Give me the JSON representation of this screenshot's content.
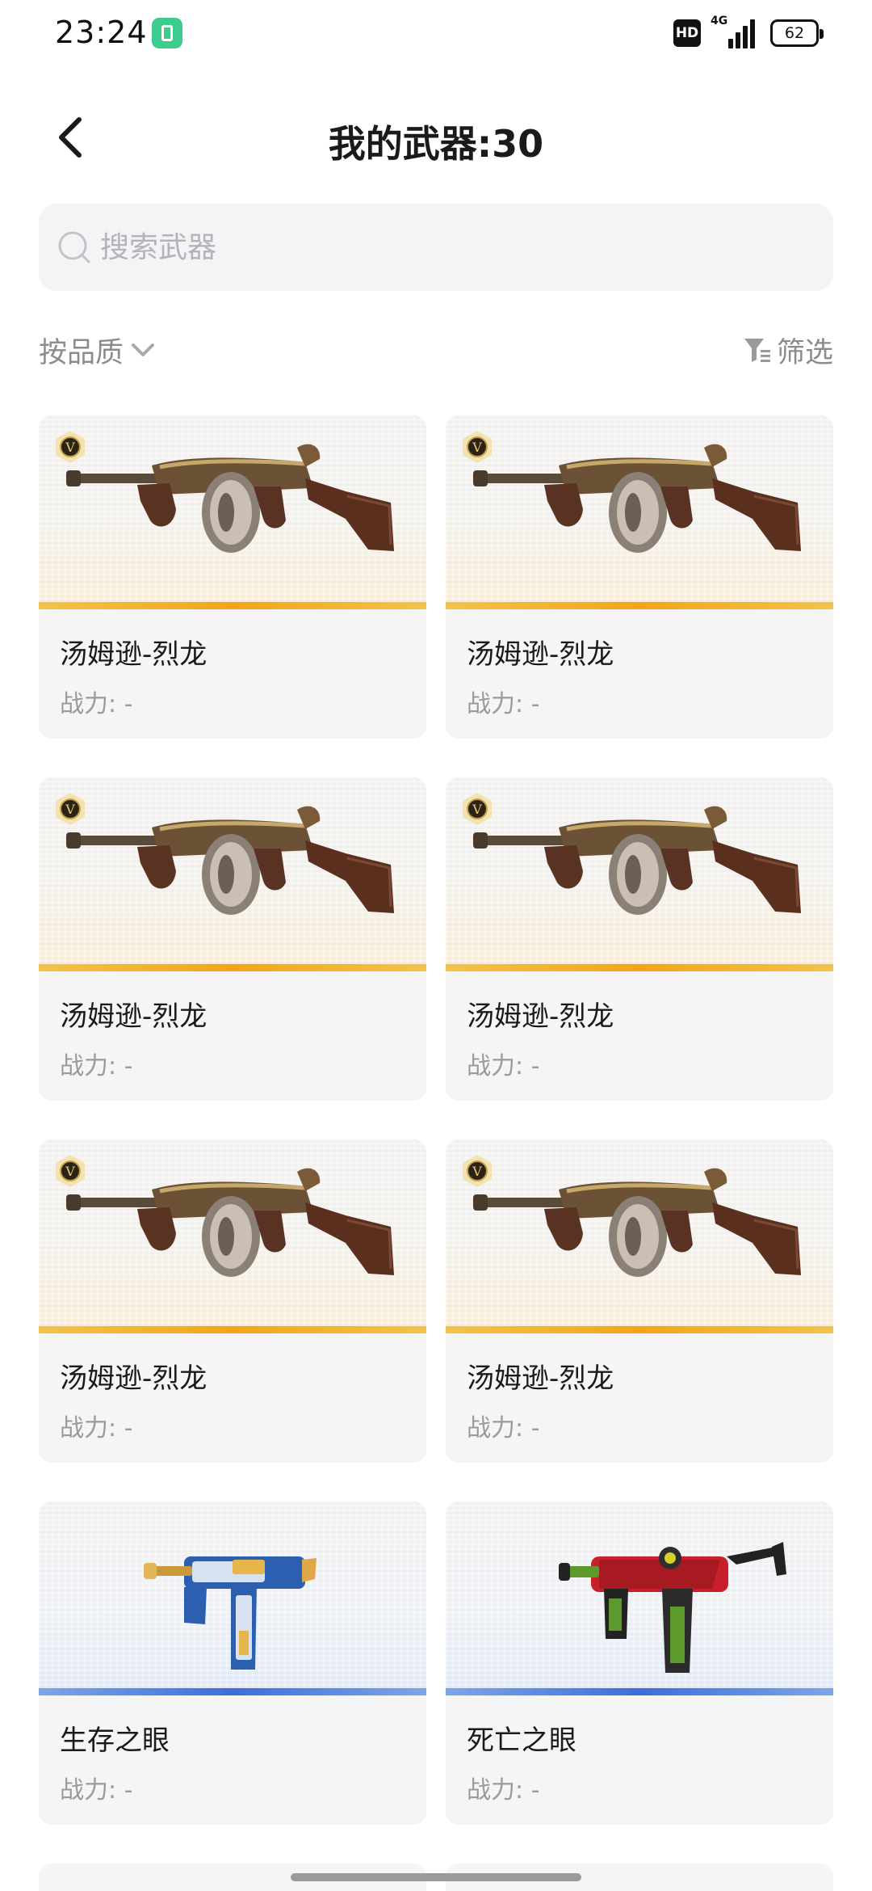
{
  "status_bar": {
    "time": "23:24",
    "hd": "HD",
    "network": "4G",
    "battery": "62"
  },
  "header": {
    "title": "我的武器:30"
  },
  "search": {
    "placeholder": "搜索武器"
  },
  "toolbar": {
    "sort_label": "按品质",
    "filter_label": "筛选"
  },
  "weapons": [
    {
      "name": "汤姆逊-烈龙",
      "power": "战力: -",
      "rarity": "gold",
      "badge": "V",
      "icon": "tommy-gun-dragon"
    },
    {
      "name": "汤姆逊-烈龙",
      "power": "战力: -",
      "rarity": "gold",
      "badge": "V",
      "icon": "tommy-gun-dragon"
    },
    {
      "name": "汤姆逊-烈龙",
      "power": "战力: -",
      "rarity": "gold",
      "badge": "V",
      "icon": "tommy-gun-dragon"
    },
    {
      "name": "汤姆逊-烈龙",
      "power": "战力: -",
      "rarity": "gold",
      "badge": "V",
      "icon": "tommy-gun-dragon"
    },
    {
      "name": "汤姆逊-烈龙",
      "power": "战力: -",
      "rarity": "gold",
      "badge": "V",
      "icon": "tommy-gun-dragon"
    },
    {
      "name": "汤姆逊-烈龙",
      "power": "战力: -",
      "rarity": "gold",
      "badge": "V",
      "icon": "tommy-gun-dragon"
    },
    {
      "name": "生存之眼",
      "power": "战力: -",
      "rarity": "blue",
      "icon": "smg-blue-gold"
    },
    {
      "name": "死亡之眼",
      "power": "战力: -",
      "rarity": "blue",
      "icon": "smg-red-green"
    }
  ],
  "colors": {
    "gold_stripe": "#f5a418",
    "blue_stripe": "#3a6fdc",
    "card_bg": "#f5f5f6",
    "search_bg": "#f4f4f6"
  }
}
